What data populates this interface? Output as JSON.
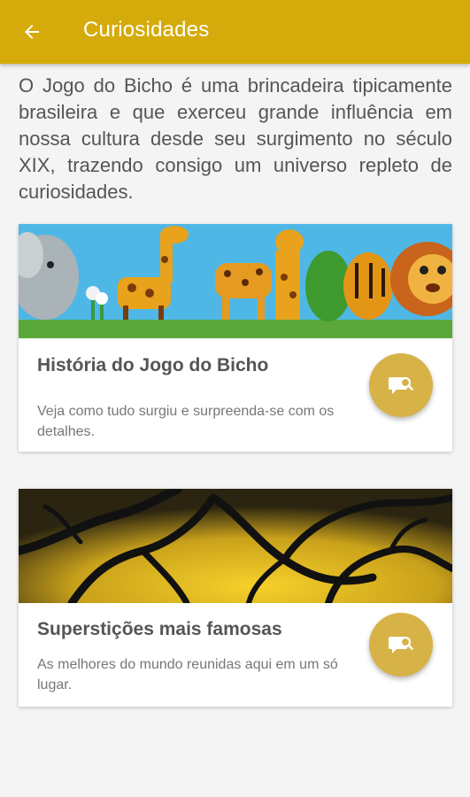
{
  "appbar": {
    "title": "Curiosidades",
    "back_icon": "arrow-left-icon",
    "color": "#d4ab0a"
  },
  "intro": {
    "text": "O Jogo do Bicho é uma brincadeira tipicamente brasileira e que exerceu grande influência em nossa cultura desde seu surgimento no século XIX, trazendo consigo um universo repleto de curiosidades."
  },
  "cards": [
    {
      "title": "História do Jogo do Bicho",
      "description": "Veja como tudo surgiu e surpreenda-se com os detalhes.",
      "image": "cartoon-animals-illustration",
      "action_icon": "chat-search-icon"
    },
    {
      "title": "Superstições mais famosas",
      "description": "As melhores do mundo reunidas aqui em um só lugar.",
      "image": "dark-branches-on-yellow-illustration",
      "action_icon": "chat-search-icon"
    }
  ],
  "colors": {
    "accent": "#d4ab0a",
    "fab": "#d7b246"
  }
}
